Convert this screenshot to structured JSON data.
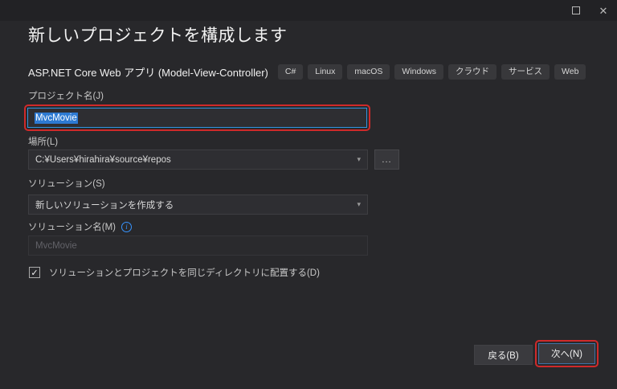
{
  "window": {
    "controls": {
      "maximize": "maximize",
      "close_glyph": "✕"
    }
  },
  "dialog": {
    "title": "新しいプロジェクトを構成します",
    "project_type": {
      "name": "ASP.NET Core Web アプリ (Model-View-Controller)",
      "tags": [
        "C#",
        "Linux",
        "macOS",
        "Windows",
        "クラウド",
        "サービス",
        "Web"
      ]
    },
    "fields": {
      "project_name": {
        "label": "プロジェクト名(J)",
        "value": "MvcMovie",
        "selected": true
      },
      "location": {
        "label": "場所(L)",
        "value": "C:¥Users¥hirahira¥source¥repos",
        "browse_label": "..."
      },
      "solution": {
        "label": "ソリューション(S)",
        "value": "新しいソリューションを作成する"
      },
      "solution_name": {
        "label": "ソリューション名(M)",
        "value": "MvcMovie",
        "disabled": true
      }
    },
    "checkbox": {
      "label": "ソリューションとプロジェクトを同じディレクトリに配置する(D)",
      "checked": true
    },
    "buttons": {
      "back": "戻る(B)",
      "next": "次へ(N)"
    }
  },
  "icons": {
    "caret_down": "▾",
    "check": "✓",
    "info": "i"
  },
  "colors": {
    "background": "#28282b",
    "titlebar": "#222225",
    "accent_blue": "#3295e0",
    "selection_blue": "#2d7ad2",
    "annotation_red": "#d02a2a"
  }
}
